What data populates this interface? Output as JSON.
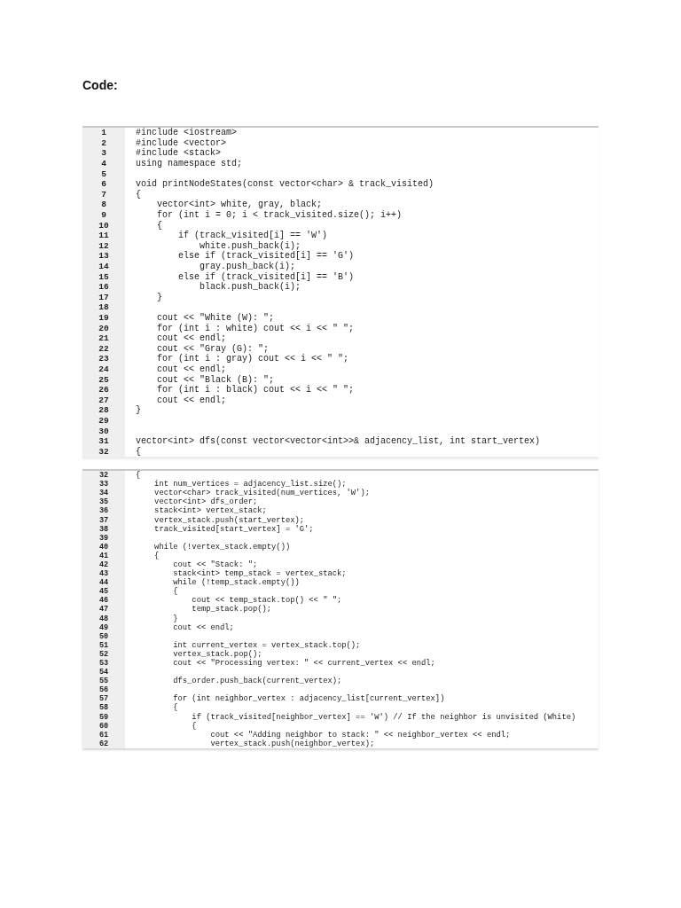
{
  "heading": "Code:",
  "panels": [
    {
      "lines": [
        {
          "number": "1",
          "code": "#include <iostream>"
        },
        {
          "number": "2",
          "code": "#include <vector>"
        },
        {
          "number": "3",
          "code": "#include <stack>"
        },
        {
          "number": "4",
          "code": "using namespace std;"
        },
        {
          "number": "5"
        },
        {
          "number": "6",
          "code": "void printNodeStates(const vector<char> & track_visited)"
        },
        {
          "number": "7",
          "code": "{"
        },
        {
          "number": "8",
          "code": "    vector<int> white, gray, black;"
        },
        {
          "number": "9",
          "code": "    for (int i = 0; i < track_visited.size(); i++)"
        },
        {
          "number": "10",
          "code": "    {"
        },
        {
          "number": "11",
          "code": "        if (track_visited[i] == 'W')"
        },
        {
          "number": "12",
          "code": "            white.push_back(i);"
        },
        {
          "number": "13",
          "code": "        else if (track_visited[i] == 'G')"
        },
        {
          "number": "14",
          "code": "            gray.push_back(i);"
        },
        {
          "number": "15",
          "code": "        else if (track_visited[i] == 'B')"
        },
        {
          "number": "16",
          "code": "            black.push_back(i);"
        },
        {
          "number": "17",
          "code": "    }"
        },
        {
          "number": "18"
        },
        {
          "number": "19",
          "code": "    cout << \"White (W): \";"
        },
        {
          "number": "20",
          "code": "    for (int i : white) cout << i << \" \";"
        },
        {
          "number": "21",
          "code": "    cout << endl;"
        },
        {
          "number": "22",
          "code": "    cout << \"Gray (G): \";"
        },
        {
          "number": "23",
          "code": "    for (int i : gray) cout << i << \" \";"
        },
        {
          "number": "24",
          "code": "    cout << endl;"
        },
        {
          "number": "25",
          "code": "    cout << \"Black (B): \";"
        },
        {
          "number": "26",
          "code": "    for (int i : black) cout << i << \" \";"
        },
        {
          "number": "27",
          "code": "    cout << endl;"
        },
        {
          "number": "28",
          "code": "}"
        },
        {
          "number": "29"
        },
        {
          "number": "30"
        },
        {
          "number": "31",
          "code": "vector<int> dfs(const vector<vector<int>>& adjacency_list, int start_vertex)"
        },
        {
          "number": "32",
          "code": "{"
        }
      ]
    },
    {
      "lines": [
        {
          "number": "32",
          "code": "{"
        },
        {
          "number": "33",
          "code": "    int num_vertices = adjacency_list.size();"
        },
        {
          "number": "34",
          "code": "    vector<char> track_visited(num_vertices, 'W');"
        },
        {
          "number": "35",
          "code": "    vector<int> dfs_order;"
        },
        {
          "number": "36",
          "code": "    stack<int> vertex_stack;"
        },
        {
          "number": "37",
          "code": "    vertex_stack.push(start_vertex);"
        },
        {
          "number": "38",
          "code": "    track_visited[start_vertex] = 'G';"
        },
        {
          "number": "39"
        },
        {
          "number": "40",
          "code": "    while (!vertex_stack.empty())"
        },
        {
          "number": "41",
          "code": "    {"
        },
        {
          "number": "42",
          "code": "        cout << \"Stack: \";"
        },
        {
          "number": "43",
          "code": "        stack<int> temp_stack = vertex_stack;"
        },
        {
          "number": "44",
          "code": "        while (!temp_stack.empty())"
        },
        {
          "number": "45",
          "code": "        {"
        },
        {
          "number": "46",
          "code": "            cout << temp_stack.top() << \" \";"
        },
        {
          "number": "47",
          "code": "            temp_stack.pop();"
        },
        {
          "number": "48",
          "code": "        }"
        },
        {
          "number": "49",
          "code": "        cout << endl;"
        },
        {
          "number": "50"
        },
        {
          "number": "51",
          "code": "        int current_vertex = vertex_stack.top();"
        },
        {
          "number": "52",
          "code": "        vertex_stack.pop();"
        },
        {
          "number": "53",
          "code": "        cout << \"Processing vertex: \" << current_vertex << endl;"
        },
        {
          "number": "54"
        },
        {
          "number": "55",
          "code": "        dfs_order.push_back(current_vertex);"
        },
        {
          "number": "56"
        },
        {
          "number": "57",
          "code": "        for (int neighbor_vertex : adjacency_list[current_vertex])"
        },
        {
          "number": "58",
          "code": "        {"
        },
        {
          "number": "59",
          "code": "            if (track_visited[neighbor_vertex] == 'W') // If the neighbor is unvisited (White)"
        },
        {
          "number": "60",
          "code": "            {"
        },
        {
          "number": "61",
          "code": "                cout << \"Adding neighbor to stack: \" << neighbor_vertex << endl;"
        },
        {
          "number": "62",
          "code": "                vertex_stack.push(neighbor_vertex);"
        }
      ]
    }
  ]
}
